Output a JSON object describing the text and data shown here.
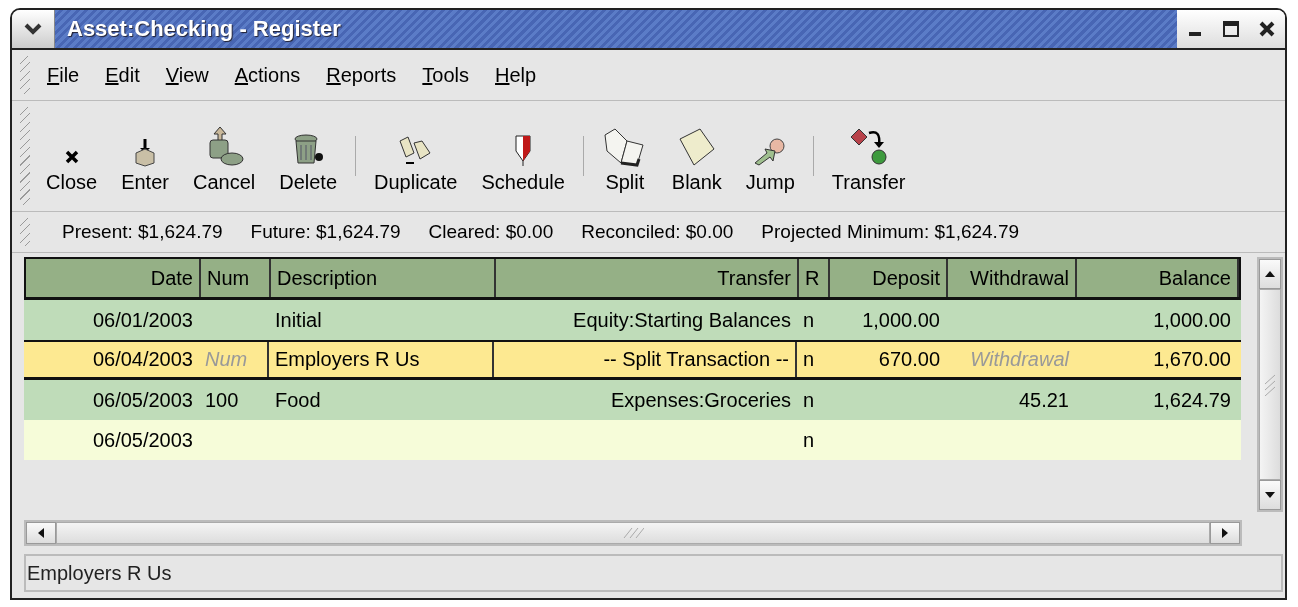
{
  "window": {
    "title": "Asset:Checking - Register"
  },
  "menu": [
    "File",
    "Edit",
    "View",
    "Actions",
    "Reports",
    "Tools",
    "Help"
  ],
  "toolbar": [
    {
      "kind": "button",
      "label": "Close"
    },
    {
      "kind": "button",
      "label": "Enter"
    },
    {
      "kind": "button",
      "label": "Cancel"
    },
    {
      "kind": "button",
      "label": "Delete"
    },
    {
      "kind": "separator"
    },
    {
      "kind": "button",
      "label": "Duplicate"
    },
    {
      "kind": "button",
      "label": "Schedule"
    },
    {
      "kind": "separator"
    },
    {
      "kind": "button",
      "label": "Split"
    },
    {
      "kind": "button",
      "label": "Blank"
    },
    {
      "kind": "button",
      "label": "Jump"
    },
    {
      "kind": "separator"
    },
    {
      "kind": "button",
      "label": "Transfer"
    }
  ],
  "summary": [
    "Present: $1,624.79",
    "Future: $1,624.79",
    "Cleared: $0.00",
    "Reconciled: $0.00",
    "Projected Minimum: $1,624.79"
  ],
  "table": {
    "columns": [
      "Date",
      "Num",
      "Description",
      "Transfer",
      "R",
      "Deposit",
      "Withdrawal",
      "Balance"
    ],
    "rows": [
      {
        "kind": "transaction",
        "selected": false,
        "cells": [
          "06/01/2003",
          "",
          "Initial",
          "Equity:Starting Balances",
          "n",
          "1,000.00",
          "",
          "1,000.00"
        ]
      },
      {
        "kind": "transaction",
        "selected": true,
        "cells": [
          "06/04/2003",
          "",
          "Employers R Us",
          "-- Split Transaction --",
          "n",
          "670.00",
          "",
          "1,670.00"
        ],
        "placeholders": {
          "num": "Num",
          "withdrawal": "Withdrawal"
        }
      },
      {
        "kind": "transaction",
        "selected": false,
        "cells": [
          "06/05/2003",
          "100",
          "Food",
          "Expenses:Groceries",
          "n",
          "",
          "45.21",
          "1,624.79"
        ]
      },
      {
        "kind": "blank",
        "selected": false,
        "cells": [
          "06/05/2003",
          "",
          "",
          "",
          "n",
          "",
          "",
          ""
        ]
      }
    ]
  },
  "status_bar": "Employers R Us"
}
